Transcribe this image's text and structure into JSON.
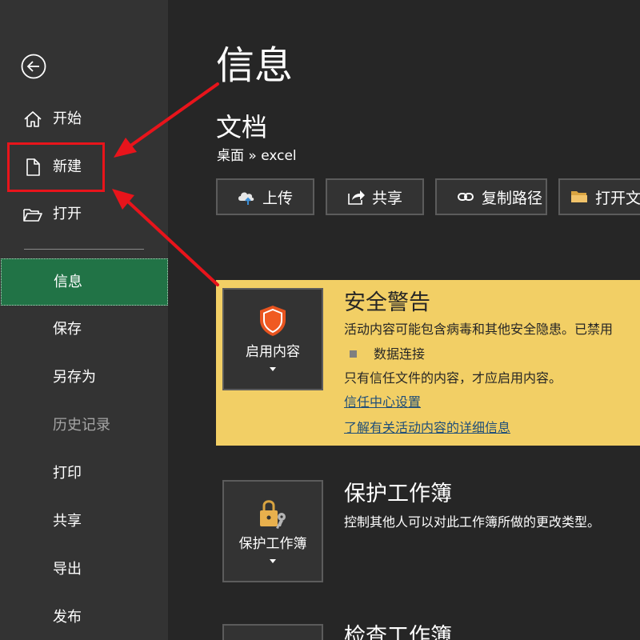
{
  "sidebar": {
    "back_icon": "back-arrow-icon",
    "items": [
      {
        "label": "开始",
        "icon": "home-icon",
        "state": "normal"
      },
      {
        "label": "新建",
        "icon": "new-document-icon",
        "state": "normal"
      },
      {
        "label": "打开",
        "icon": "open-folder-icon",
        "state": "normal"
      },
      {
        "label": "信息",
        "state": "active"
      },
      {
        "label": "保存",
        "state": "normal"
      },
      {
        "label": "另存为",
        "state": "normal"
      },
      {
        "label": "历史记录",
        "state": "disabled"
      },
      {
        "label": "打印",
        "state": "normal"
      },
      {
        "label": "共享",
        "state": "normal"
      },
      {
        "label": "导出",
        "state": "normal"
      },
      {
        "label": "发布",
        "state": "normal"
      }
    ]
  },
  "header": {
    "title": "信息",
    "document_title": "文档",
    "breadcrumb": "桌面 » excel"
  },
  "actions": [
    {
      "label": "上传",
      "icon": "upload-cloud-icon"
    },
    {
      "label": "共享",
      "icon": "share-icon"
    },
    {
      "label": "复制路径",
      "icon": "link-icon"
    },
    {
      "label": "打开文",
      "icon": "folder-icon"
    }
  ],
  "security_warning": {
    "button_label": "启用内容",
    "button_icon": "shield-icon",
    "title": "安全警告",
    "description": "活动内容可能包含病毒和其他安全隐患。已禁用",
    "bullet": "数据连接",
    "note": "只有信任文件的内容，才应启用内容。",
    "link_trust_center": "信任中心设置",
    "link_learn_more": "了解有关活动内容的详细信息"
  },
  "protect_workbook": {
    "button_label": "保护工作簿",
    "button_icon": "lock-key-icon",
    "title": "保护工作簿",
    "description": "控制其他人可以对此工作簿所做的更改类型。"
  },
  "inspect_workbook": {
    "title": "检查工作簿"
  },
  "colors": {
    "sidebar_bg": "#333333",
    "main_bg": "#262626",
    "active_green": "#217346",
    "warning_yellow": "#f2cf65",
    "annotation_red": "#e8141b",
    "link_blue": "#1f4e79"
  }
}
